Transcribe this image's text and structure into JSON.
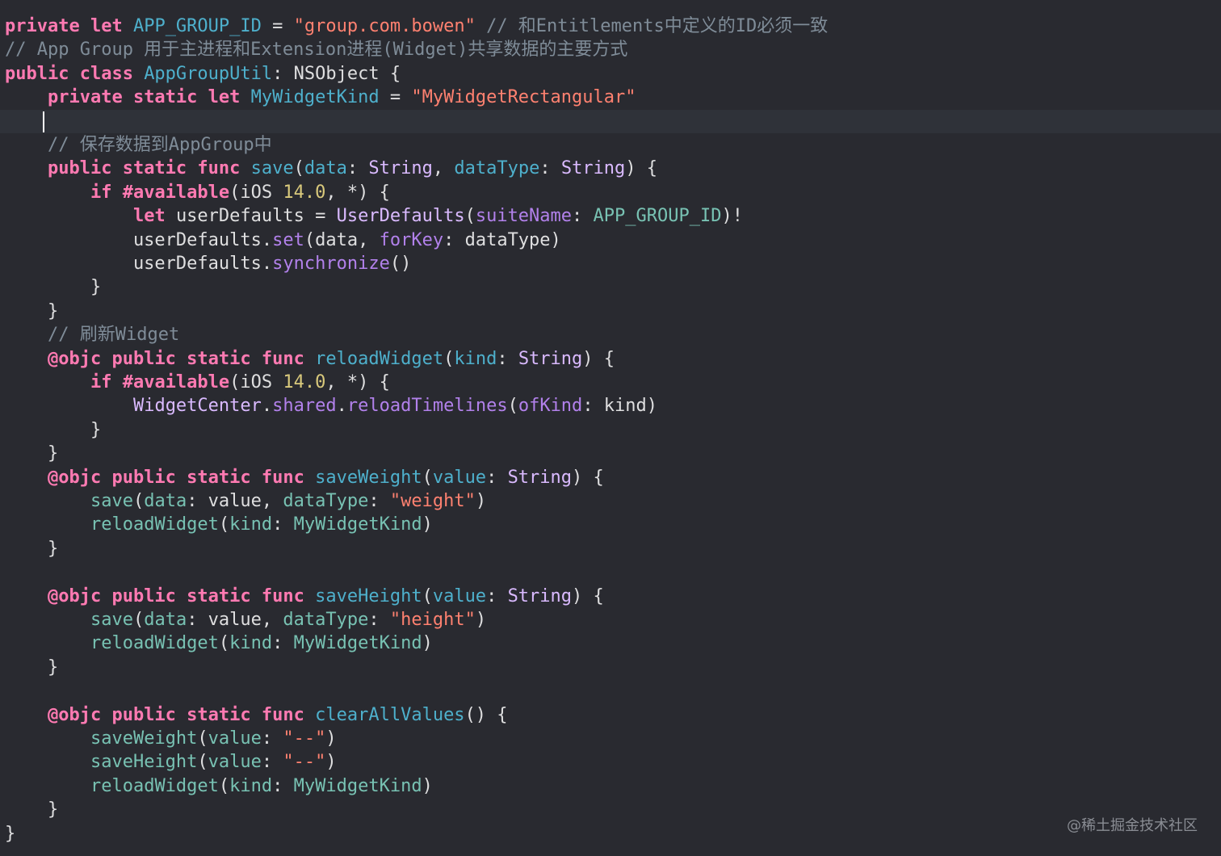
{
  "theme": {
    "background": "#292a30",
    "current_line": "#2f3239",
    "keyword": "#ff7ab2",
    "type": "#dabaff",
    "declaration": "#4eb0cc",
    "function": "#b281eb",
    "identifier": "#78c2b3",
    "string": "#ff8170",
    "number": "#d9c97c",
    "comment": "#7f8c98",
    "plain": "#dfdfe0"
  },
  "code": {
    "lines": [
      {
        "segments": [
          {
            "t": "private let ",
            "c": "kw"
          },
          {
            "t": "APP_GROUP_ID",
            "c": "decl"
          },
          {
            "t": " = ",
            "c": "pl"
          },
          {
            "t": "\"group.com.bowen\"",
            "c": "str"
          },
          {
            "t": " // 和Entitlements中定义的ID必须一致",
            "c": "cm"
          }
        ]
      },
      {
        "segments": [
          {
            "t": "// App Group 用于主进程和Extension进程(Widget)共享数据的主要方式",
            "c": "cm"
          }
        ]
      },
      {
        "segments": [
          {
            "t": "public class ",
            "c": "kw"
          },
          {
            "t": "AppGroupUtil",
            "c": "decl"
          },
          {
            "t": ": NSObject {",
            "c": "pl"
          }
        ]
      },
      {
        "segments": [
          {
            "t": "    ",
            "c": "pl"
          },
          {
            "t": "private static let ",
            "c": "kw"
          },
          {
            "t": "MyWidgetKind",
            "c": "decl"
          },
          {
            "t": " = ",
            "c": "pl"
          },
          {
            "t": "\"MyWidgetRectangular\"",
            "c": "str"
          }
        ]
      },
      {
        "current": true,
        "segments": []
      },
      {
        "segments": [
          {
            "t": "    // 保存数据到AppGroup中",
            "c": "cm"
          }
        ]
      },
      {
        "segments": [
          {
            "t": "    ",
            "c": "pl"
          },
          {
            "t": "public static func ",
            "c": "kw"
          },
          {
            "t": "save",
            "c": "decl"
          },
          {
            "t": "(",
            "c": "pl"
          },
          {
            "t": "data",
            "c": "decl"
          },
          {
            "t": ": ",
            "c": "pl"
          },
          {
            "t": "String",
            "c": "ty"
          },
          {
            "t": ", ",
            "c": "pl"
          },
          {
            "t": "dataType",
            "c": "decl"
          },
          {
            "t": ": ",
            "c": "pl"
          },
          {
            "t": "String",
            "c": "ty"
          },
          {
            "t": ") {",
            "c": "pl"
          }
        ]
      },
      {
        "segments": [
          {
            "t": "        ",
            "c": "pl"
          },
          {
            "t": "if #available",
            "c": "kw"
          },
          {
            "t": "(iOS ",
            "c": "pl"
          },
          {
            "t": "14.0",
            "c": "num"
          },
          {
            "t": ", *) {",
            "c": "pl"
          }
        ]
      },
      {
        "segments": [
          {
            "t": "            ",
            "c": "pl"
          },
          {
            "t": "let ",
            "c": "kw"
          },
          {
            "t": "userDefaults = ",
            "c": "pl"
          },
          {
            "t": "UserDefaults",
            "c": "ty"
          },
          {
            "t": "(",
            "c": "pl"
          },
          {
            "t": "suiteName",
            "c": "fn"
          },
          {
            "t": ": ",
            "c": "pl"
          },
          {
            "t": "APP_GROUP_ID",
            "c": "id"
          },
          {
            "t": ")!",
            "c": "pl"
          }
        ]
      },
      {
        "segments": [
          {
            "t": "            userDefaults.",
            "c": "pl"
          },
          {
            "t": "set",
            "c": "fn"
          },
          {
            "t": "(data, ",
            "c": "pl"
          },
          {
            "t": "forKey",
            "c": "fn"
          },
          {
            "t": ": dataType)",
            "c": "pl"
          }
        ]
      },
      {
        "segments": [
          {
            "t": "            userDefaults.",
            "c": "pl"
          },
          {
            "t": "synchronize",
            "c": "fn"
          },
          {
            "t": "()",
            "c": "pl"
          }
        ]
      },
      {
        "segments": [
          {
            "t": "        }",
            "c": "pl"
          }
        ]
      },
      {
        "segments": [
          {
            "t": "    }",
            "c": "pl"
          }
        ]
      },
      {
        "segments": [
          {
            "t": "    // 刷新Widget",
            "c": "cm"
          }
        ]
      },
      {
        "segments": [
          {
            "t": "    ",
            "c": "pl"
          },
          {
            "t": "@objc public static func ",
            "c": "kw"
          },
          {
            "t": "reloadWidget",
            "c": "decl"
          },
          {
            "t": "(",
            "c": "pl"
          },
          {
            "t": "kind",
            "c": "decl"
          },
          {
            "t": ": ",
            "c": "pl"
          },
          {
            "t": "String",
            "c": "ty"
          },
          {
            "t": ") {",
            "c": "pl"
          }
        ]
      },
      {
        "segments": [
          {
            "t": "        ",
            "c": "pl"
          },
          {
            "t": "if #available",
            "c": "kw"
          },
          {
            "t": "(iOS ",
            "c": "pl"
          },
          {
            "t": "14.0",
            "c": "num"
          },
          {
            "t": ", *) {",
            "c": "pl"
          }
        ]
      },
      {
        "segments": [
          {
            "t": "            ",
            "c": "pl"
          },
          {
            "t": "WidgetCenter",
            "c": "ty"
          },
          {
            "t": ".",
            "c": "pl"
          },
          {
            "t": "shared",
            "c": "fn"
          },
          {
            "t": ".",
            "c": "pl"
          },
          {
            "t": "reloadTimelines",
            "c": "fn"
          },
          {
            "t": "(",
            "c": "pl"
          },
          {
            "t": "ofKind",
            "c": "fn"
          },
          {
            "t": ": kind)",
            "c": "pl"
          }
        ]
      },
      {
        "segments": [
          {
            "t": "        }",
            "c": "pl"
          }
        ]
      },
      {
        "segments": [
          {
            "t": "    }",
            "c": "pl"
          }
        ]
      },
      {
        "segments": [
          {
            "t": "    ",
            "c": "pl"
          },
          {
            "t": "@objc public static func ",
            "c": "kw"
          },
          {
            "t": "saveWeight",
            "c": "decl"
          },
          {
            "t": "(",
            "c": "pl"
          },
          {
            "t": "value",
            "c": "decl"
          },
          {
            "t": ": ",
            "c": "pl"
          },
          {
            "t": "String",
            "c": "ty"
          },
          {
            "t": ") {",
            "c": "pl"
          }
        ]
      },
      {
        "segments": [
          {
            "t": "        ",
            "c": "pl"
          },
          {
            "t": "save",
            "c": "id"
          },
          {
            "t": "(",
            "c": "pl"
          },
          {
            "t": "data",
            "c": "id"
          },
          {
            "t": ": value, ",
            "c": "pl"
          },
          {
            "t": "dataType",
            "c": "id"
          },
          {
            "t": ": ",
            "c": "pl"
          },
          {
            "t": "\"weight\"",
            "c": "str"
          },
          {
            "t": ")",
            "c": "pl"
          }
        ]
      },
      {
        "segments": [
          {
            "t": "        ",
            "c": "pl"
          },
          {
            "t": "reloadWidget",
            "c": "id"
          },
          {
            "t": "(",
            "c": "pl"
          },
          {
            "t": "kind",
            "c": "id"
          },
          {
            "t": ": ",
            "c": "pl"
          },
          {
            "t": "MyWidgetKind",
            "c": "id"
          },
          {
            "t": ")",
            "c": "pl"
          }
        ]
      },
      {
        "segments": [
          {
            "t": "    }",
            "c": "pl"
          }
        ]
      },
      {
        "segments": []
      },
      {
        "segments": [
          {
            "t": "    ",
            "c": "pl"
          },
          {
            "t": "@objc public static func ",
            "c": "kw"
          },
          {
            "t": "saveHeight",
            "c": "decl"
          },
          {
            "t": "(",
            "c": "pl"
          },
          {
            "t": "value",
            "c": "decl"
          },
          {
            "t": ": ",
            "c": "pl"
          },
          {
            "t": "String",
            "c": "ty"
          },
          {
            "t": ") {",
            "c": "pl"
          }
        ]
      },
      {
        "segments": [
          {
            "t": "        ",
            "c": "pl"
          },
          {
            "t": "save",
            "c": "id"
          },
          {
            "t": "(",
            "c": "pl"
          },
          {
            "t": "data",
            "c": "id"
          },
          {
            "t": ": value, ",
            "c": "pl"
          },
          {
            "t": "dataType",
            "c": "id"
          },
          {
            "t": ": ",
            "c": "pl"
          },
          {
            "t": "\"height\"",
            "c": "str"
          },
          {
            "t": ")",
            "c": "pl"
          }
        ]
      },
      {
        "segments": [
          {
            "t": "        ",
            "c": "pl"
          },
          {
            "t": "reloadWidget",
            "c": "id"
          },
          {
            "t": "(",
            "c": "pl"
          },
          {
            "t": "kind",
            "c": "id"
          },
          {
            "t": ": ",
            "c": "pl"
          },
          {
            "t": "MyWidgetKind",
            "c": "id"
          },
          {
            "t": ")",
            "c": "pl"
          }
        ]
      },
      {
        "segments": [
          {
            "t": "    }",
            "c": "pl"
          }
        ]
      },
      {
        "segments": []
      },
      {
        "segments": [
          {
            "t": "    ",
            "c": "pl"
          },
          {
            "t": "@objc public static func ",
            "c": "kw"
          },
          {
            "t": "clearAllValues",
            "c": "decl"
          },
          {
            "t": "() {",
            "c": "pl"
          }
        ]
      },
      {
        "segments": [
          {
            "t": "        ",
            "c": "pl"
          },
          {
            "t": "saveWeight",
            "c": "id"
          },
          {
            "t": "(",
            "c": "pl"
          },
          {
            "t": "value",
            "c": "id"
          },
          {
            "t": ": ",
            "c": "pl"
          },
          {
            "t": "\"--\"",
            "c": "str"
          },
          {
            "t": ")",
            "c": "pl"
          }
        ]
      },
      {
        "segments": [
          {
            "t": "        ",
            "c": "pl"
          },
          {
            "t": "saveHeight",
            "c": "id"
          },
          {
            "t": "(",
            "c": "pl"
          },
          {
            "t": "value",
            "c": "id"
          },
          {
            "t": ": ",
            "c": "pl"
          },
          {
            "t": "\"--\"",
            "c": "str"
          },
          {
            "t": ")",
            "c": "pl"
          }
        ]
      },
      {
        "segments": [
          {
            "t": "        ",
            "c": "pl"
          },
          {
            "t": "reloadWidget",
            "c": "id"
          },
          {
            "t": "(",
            "c": "pl"
          },
          {
            "t": "kind",
            "c": "id"
          },
          {
            "t": ": ",
            "c": "pl"
          },
          {
            "t": "MyWidgetKind",
            "c": "id"
          },
          {
            "t": ")",
            "c": "pl"
          }
        ]
      },
      {
        "segments": [
          {
            "t": "    }",
            "c": "pl"
          }
        ]
      },
      {
        "segments": [
          {
            "t": "}",
            "c": "pl"
          }
        ]
      }
    ]
  },
  "watermark": "@稀土掘金技术社区"
}
